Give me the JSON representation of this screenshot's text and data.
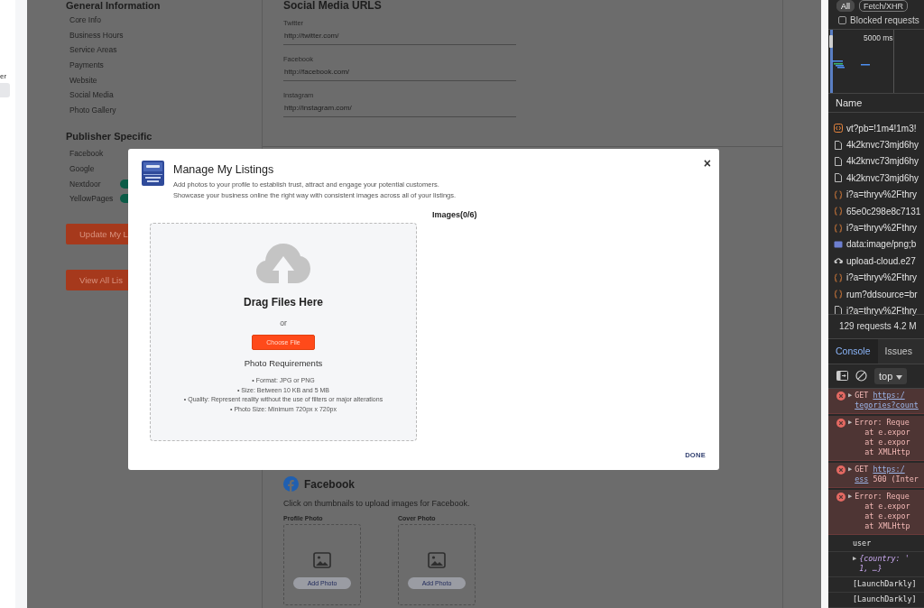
{
  "left_strip": {
    "label": "er",
    "highlight": true
  },
  "sidebar": {
    "sections": [
      {
        "title": "General Information",
        "items": [
          {
            "label": "Core Info",
            "kind": "plain"
          },
          {
            "label": "Business Hours",
            "kind": "plain"
          },
          {
            "label": "Service Areas",
            "kind": "plain"
          },
          {
            "label": "Payments",
            "kind": "plain"
          },
          {
            "label": "Website",
            "kind": "plain"
          },
          {
            "label": "Social Media",
            "kind": "plain"
          },
          {
            "label": "Photo Gallery",
            "kind": "plain"
          }
        ]
      },
      {
        "title": "Publisher Specific",
        "items": [
          {
            "label": "Facebook",
            "kind": "plain"
          },
          {
            "label": "Google",
            "kind": "plain"
          },
          {
            "label": "Nextdoor",
            "kind": "toggle",
            "on": true
          },
          {
            "label": "YellowPages",
            "kind": "toggle",
            "on": true
          }
        ]
      }
    ],
    "buttons": [
      "Update My L",
      "View All Lis"
    ]
  },
  "social_media": {
    "title": "Social Media URLS",
    "fields": [
      {
        "label": "Twitter",
        "value": "http://twitter.com/"
      },
      {
        "label": "Facebook",
        "value": "http://facebook.com/"
      },
      {
        "label": "Instagram",
        "value": "http://instagram.com/"
      }
    ]
  },
  "facebook_section": {
    "title": "Facebook",
    "hint": "Click on thumbnails to upload images for Facebook.",
    "slots": [
      {
        "label": "Profile Photo",
        "button": "Add Photo"
      },
      {
        "label": "Cover Photo",
        "button": "Add Photo"
      }
    ]
  },
  "modal": {
    "title": "Manage My Listings",
    "description": [
      "Add photos to your profile to establish trust, attract and engage your potential customers.",
      "Showcase your business online the right way with consistent images across all of your listings."
    ],
    "close": "×",
    "images_heading": "Images(0/6)",
    "dropzone": {
      "heading": "Drag Files Here",
      "separator": "or",
      "button": "Choose File",
      "requirements_title": "Photo Requirements",
      "requirements": [
        "• Format: JPG or PNG",
        "• Size: Between 10 KB and 5 MB",
        "• Quality: Represent reality without the use of filters or major alterations",
        "• Photo Size: Minimum 720px x 720px"
      ]
    },
    "done": "DONE"
  },
  "devtools": {
    "filters": [
      {
        "label": "All",
        "selected": true
      },
      {
        "label": "Fetch/XHR",
        "selected": false
      }
    ],
    "blocked_requests": {
      "label": "Blocked requests",
      "checked": false
    },
    "overview": {
      "time_label": "5000 ms"
    },
    "requests": {
      "header": "Name",
      "rows": [
        {
          "name": "vt?pb=!1m4!1m3!",
          "kind": "wasm"
        },
        {
          "name": "4k2knvc73mjd6hy",
          "kind": "document"
        },
        {
          "name": "4k2knvc73mjd6hy",
          "kind": "document"
        },
        {
          "name": "4k2knvc73mjd6hy",
          "kind": "document"
        },
        {
          "name": "i?a=thryv%2Fthry",
          "kind": "fetch"
        },
        {
          "name": "65e0c298e8c7131",
          "kind": "fetch"
        },
        {
          "name": "i?a=thryv%2Fthry",
          "kind": "fetch"
        },
        {
          "name": "data:image/png;b",
          "kind": "image"
        },
        {
          "name": "upload-cloud.e27",
          "kind": "cloud"
        },
        {
          "name": "i?a=thryv%2Fthry",
          "kind": "fetch"
        },
        {
          "name": "rum?ddsource=br",
          "kind": "fetch"
        },
        {
          "name": "i?a=thryv%2Fthry",
          "kind": "document"
        }
      ],
      "summary": "129 requests  4.2 M"
    },
    "console": {
      "tabs": [
        {
          "label": "Console",
          "selected": true
        },
        {
          "label": "Issues",
          "selected": false
        }
      ],
      "context": "top",
      "messages": [
        {
          "kind": "error",
          "expander": "▶",
          "lines": [
            [
              {
                "text": "GET ",
                "link": false
              },
              {
                "text": "https:/",
                "link": true
              }
            ],
            [
              {
                "text": "tegories?count",
                "link": true
              }
            ]
          ]
        },
        {
          "kind": "error",
          "expander": "▶",
          "lines": [
            [
              {
                "text": "Error: Reque",
                "link": false
              }
            ]
          ],
          "stack": [
            "at e.expor",
            "at e.expor",
            "at XMLHttp"
          ]
        },
        {
          "kind": "error",
          "expander": "▶",
          "lines": [
            [
              {
                "text": "GET ",
                "link": false
              },
              {
                "text": "https:/",
                "link": true
              }
            ],
            [
              {
                "text": "ess",
                "link": true
              },
              {
                "text": " 500 (Inter",
                "link": false
              }
            ]
          ]
        },
        {
          "kind": "error",
          "expander": "▶",
          "lines": [
            [
              {
                "text": "Error: Reque",
                "link": false
              }
            ]
          ],
          "stack": [
            "at e.expor",
            "at e.expor",
            "at XMLHttp"
          ]
        },
        {
          "kind": "log",
          "lines": [
            [
              {
                "text": "user",
                "link": false
              }
            ]
          ]
        },
        {
          "kind": "object",
          "expander": "▶",
          "lines": [
            [
              {
                "text": "{country: '",
                "link": false
              }
            ],
            [
              {
                "text": "1, …}",
                "link": false
              }
            ]
          ]
        },
        {
          "kind": "log",
          "lines": [
            [
              {
                "text": "[LaunchDarkly]",
                "link": false
              }
            ]
          ]
        },
        {
          "kind": "log",
          "lines": [
            [
              {
                "text": "[LaunchDarkly]",
                "link": false
              }
            ]
          ]
        }
      ]
    }
  }
}
